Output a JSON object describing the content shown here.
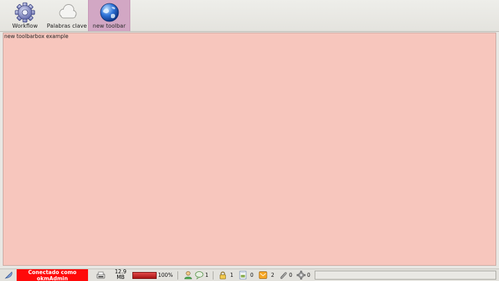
{
  "toolbar": {
    "tools": [
      {
        "label": "Workflow",
        "icon": "gear-icon",
        "active": false
      },
      {
        "label": "Palabras clave",
        "icon": "cloud-icon",
        "active": false
      },
      {
        "label": "new toolbar",
        "icon": "globe-icon",
        "active": true
      }
    ],
    "active_color": "#d2a7c4"
  },
  "main": {
    "text": "new toolbarbox example",
    "background_color": "#f7c6bd"
  },
  "statusbar": {
    "connection": "Conectado como okmAdmin",
    "connection_color": "#ff0a0a",
    "memory": "12.9 MB",
    "progress_percent": 100,
    "progress_label": "100%",
    "users_count": "1",
    "chat_count": "1",
    "locked_count": "1",
    "checkout_count": "0",
    "mail_count": "2",
    "subscribed_count": "0",
    "workflow_count": "0",
    "icons": {
      "feather": "feather-icon",
      "scanner": "scanner-icon",
      "user": "user-icon",
      "chat": "chat-icon",
      "lock": "lock-icon",
      "document": "document-icon",
      "mail": "mail-icon",
      "clip": "paperclip-icon",
      "gear": "gear-icon"
    }
  }
}
